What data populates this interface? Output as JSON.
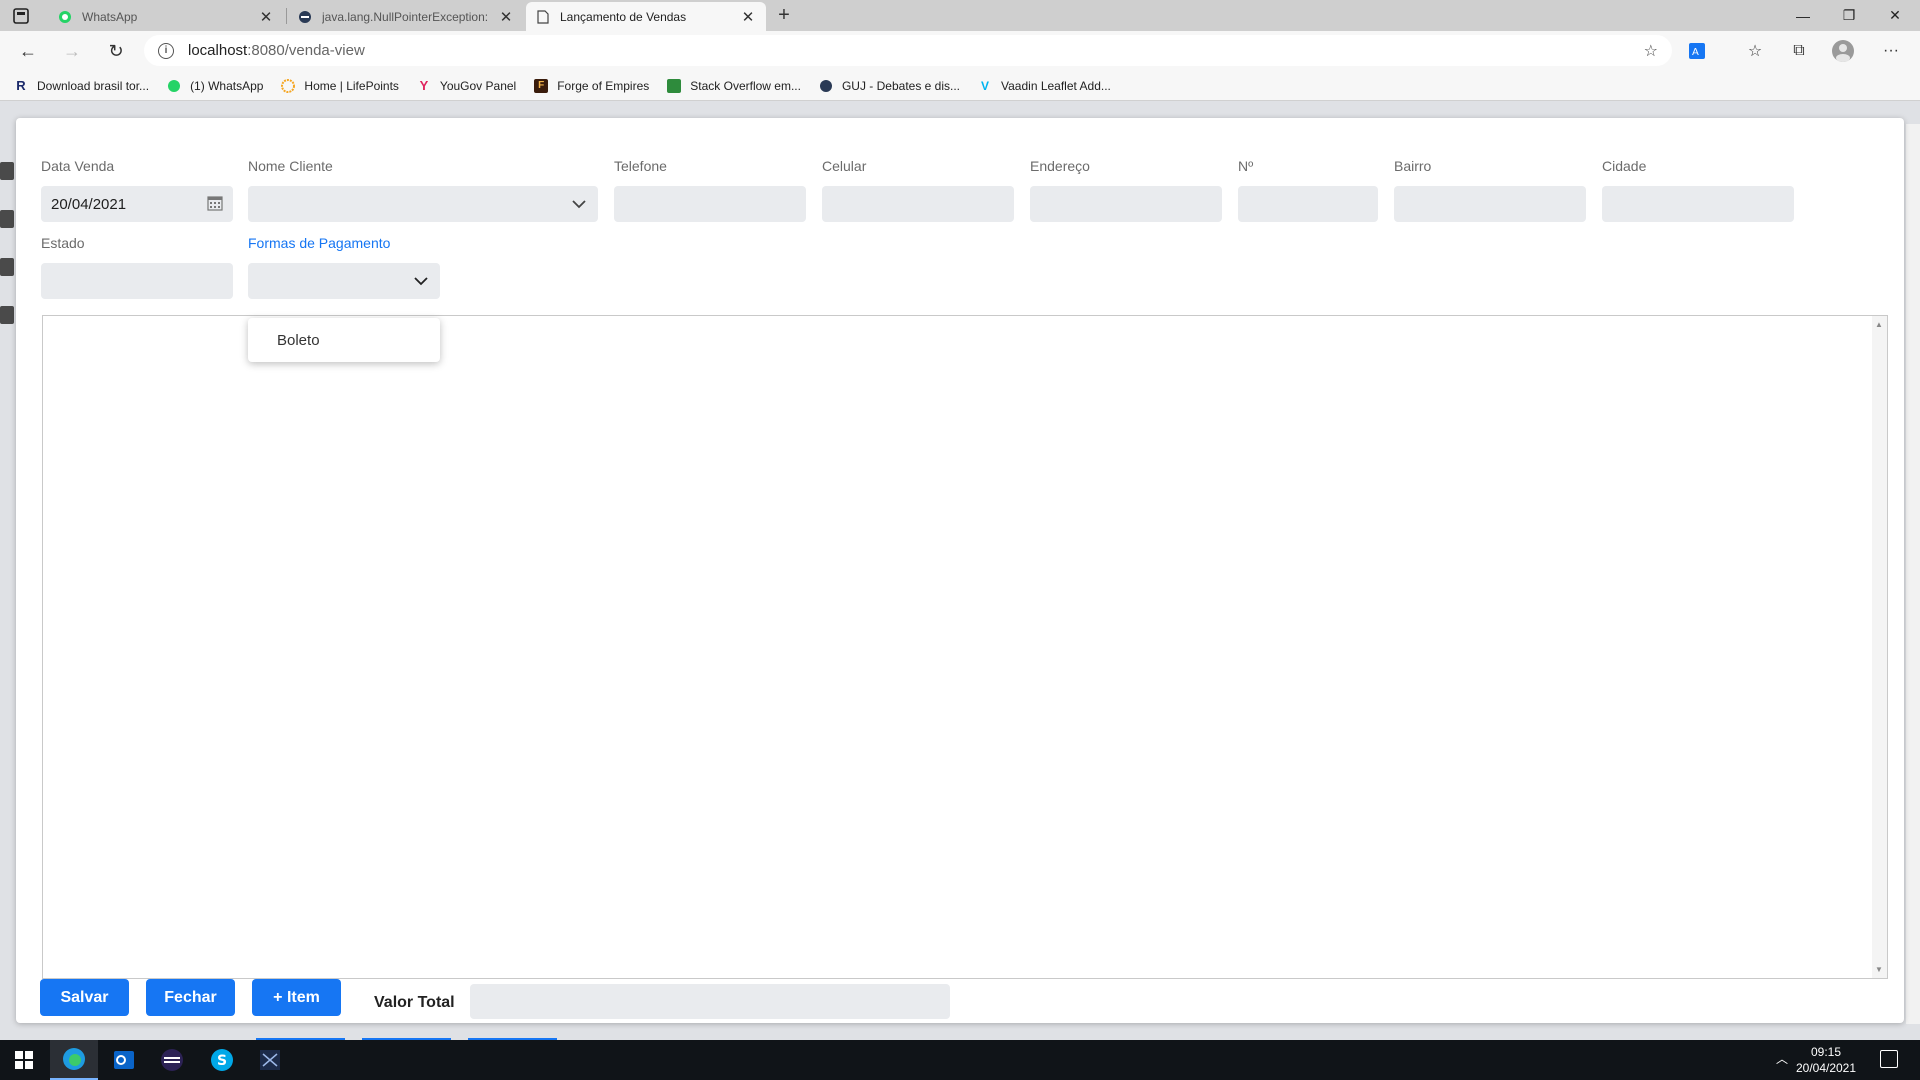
{
  "browser": {
    "tabs": [
      {
        "label": "WhatsApp"
      },
      {
        "label": "java.lang.NullPointerException: n"
      },
      {
        "label": "Lançamento de Vendas"
      }
    ],
    "address": {
      "host": "localhost",
      "path": ":8080/venda-view"
    },
    "bookmarks": [
      {
        "label": "Download brasil tor..."
      },
      {
        "label": "(1) WhatsApp"
      },
      {
        "label": "Home | LifePoints"
      },
      {
        "label": "YouGov Panel"
      },
      {
        "label": "Forge of Empires"
      },
      {
        "label": "Stack Overflow em..."
      },
      {
        "label": "GUJ - Debates e dis..."
      },
      {
        "label": "Vaadin Leaflet Add..."
      }
    ]
  },
  "form": {
    "data_venda": {
      "label": "Data Venda",
      "value": "20/04/2021"
    },
    "nome_cliente": {
      "label": "Nome Cliente",
      "value": ""
    },
    "telefone": {
      "label": "Telefone",
      "value": ""
    },
    "celular": {
      "label": "Celular",
      "value": ""
    },
    "endereco": {
      "label": "Endereço",
      "value": ""
    },
    "numero": {
      "label": "Nº",
      "value": ""
    },
    "bairro": {
      "label": "Bairro",
      "value": ""
    },
    "cidade": {
      "label": "Cidade",
      "value": ""
    },
    "estado": {
      "label": "Estado",
      "value": ""
    },
    "formas_pagamento": {
      "label": "Formas de Pagamento",
      "value": "",
      "options": [
        "Boleto"
      ]
    }
  },
  "actions": {
    "salvar": "Salvar",
    "fechar": "Fechar",
    "item": "+ Item",
    "valor_total_label": "Valor Total",
    "valor_total": ""
  },
  "taskbar": {
    "time": "09:15",
    "date": "20/04/2021"
  },
  "colors": {
    "accent": "#1676f3",
    "field_bg": "#e9ebee"
  }
}
